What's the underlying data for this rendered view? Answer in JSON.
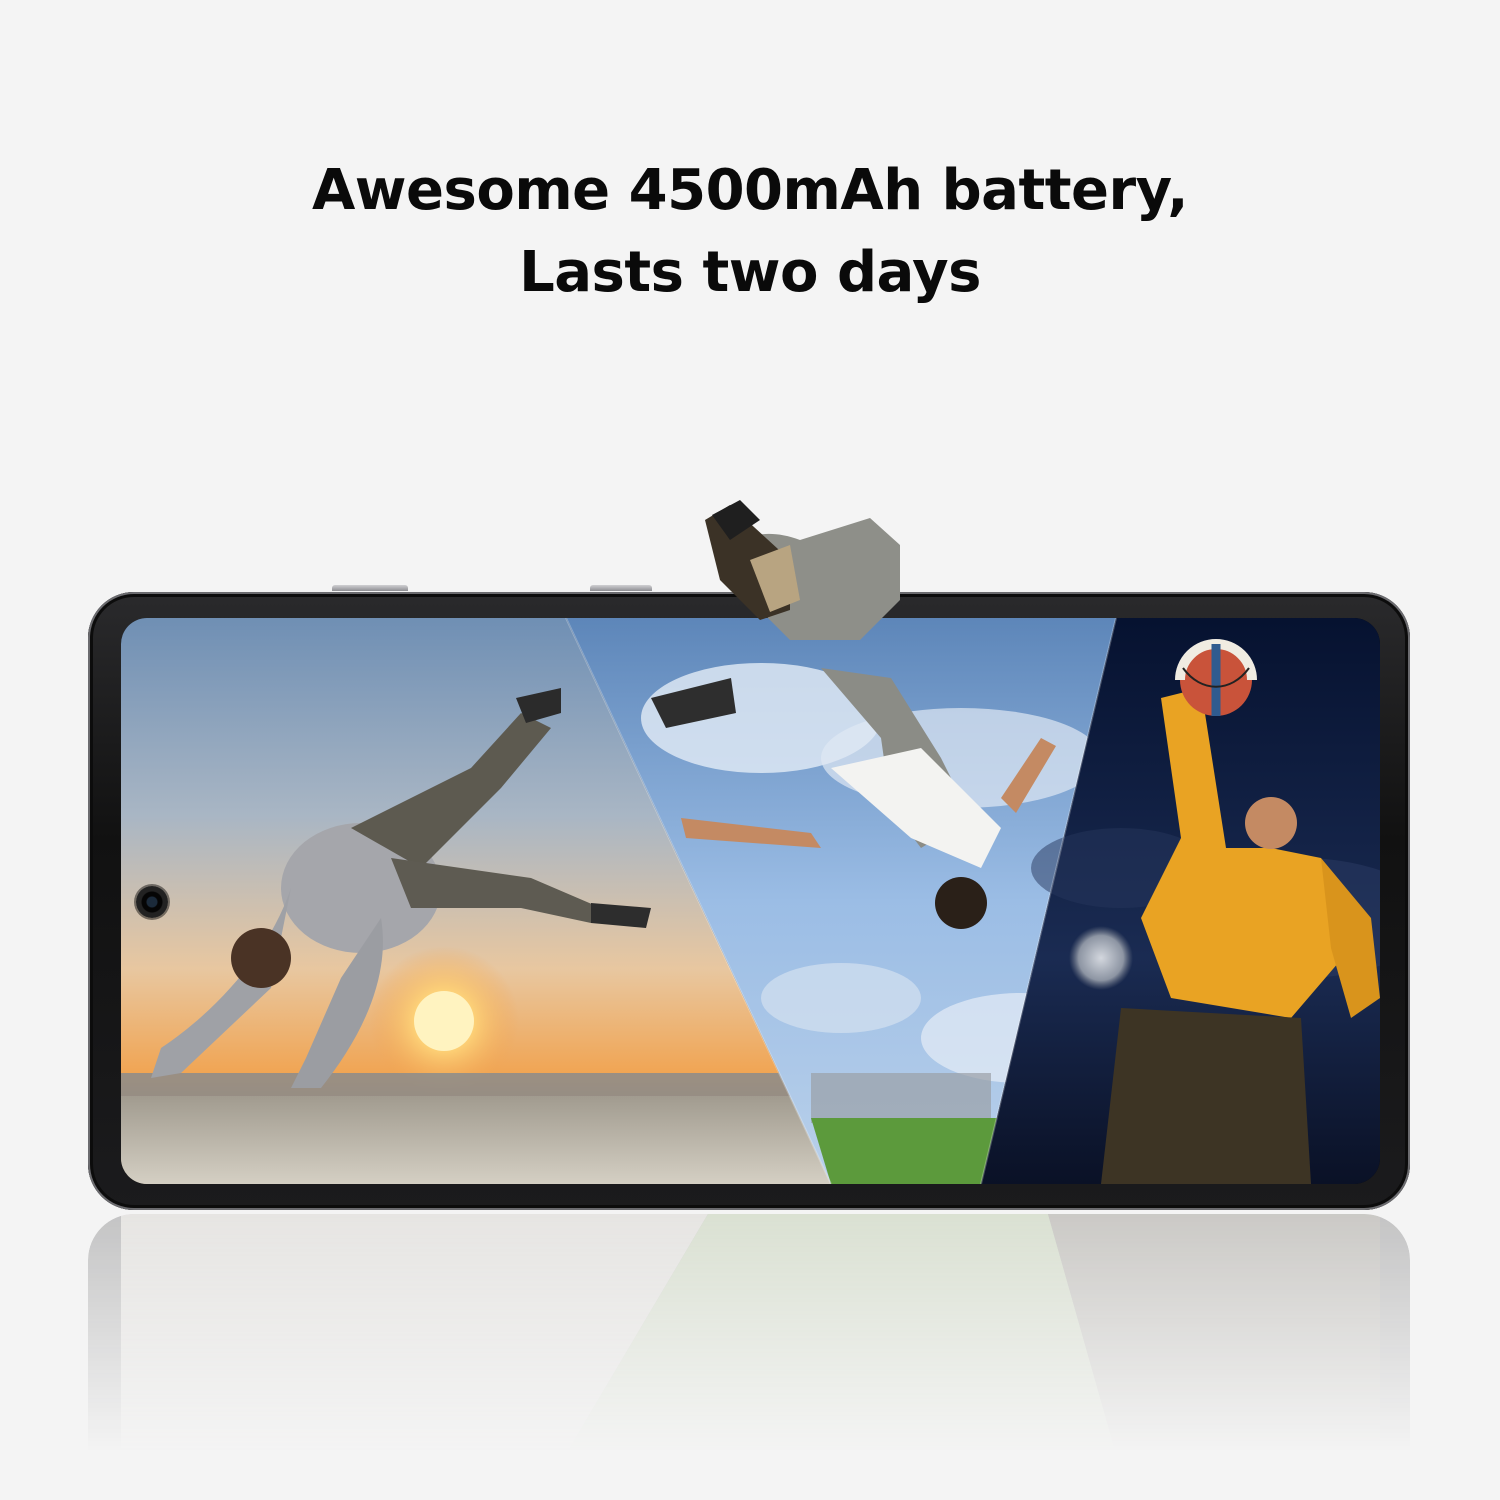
{
  "headline": {
    "line1": "Awesome 4500mAh battery,",
    "line2": "Lasts two days"
  },
  "colors": {
    "background": "#f4f4f4",
    "headline_text": "#0a0a0a",
    "phone_body": "#1a1a1c",
    "panel_sunset_sky": "#7f9bb8",
    "panel_sunset_glow": "#f0a04a",
    "panel_day_sky": "#8fb4de",
    "panel_night_sky": "#0d1a3a",
    "hoodie_yellow": "#e9a323"
  },
  "icons": {
    "camera": "camera-punch-hole-icon"
  },
  "scene": {
    "panels": [
      "sunset-breakdancer",
      "daytime-backflip",
      "night-basketball"
    ]
  }
}
